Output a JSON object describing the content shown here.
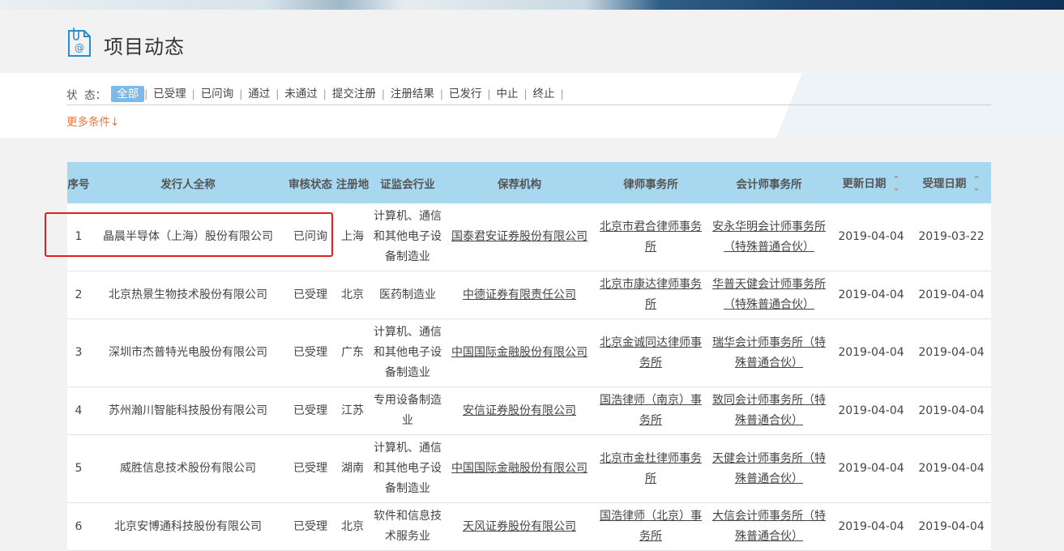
{
  "page": {
    "title": "项目动态"
  },
  "filter": {
    "label": "状  态：",
    "options": [
      "全部",
      "已受理",
      "已问询",
      "通过",
      "未通过",
      "提交注册",
      "注册结果",
      "已发行",
      "中止",
      "终止"
    ],
    "more": "更多条件↓"
  },
  "table": {
    "headers": [
      "序号",
      "发行人全称",
      "审核状态",
      "注册地",
      "证监会行业",
      "保荐机构",
      "律师事务所",
      "会计师事务所",
      "更新日期",
      "受理日期"
    ],
    "rows": [
      {
        "no": "1",
        "name": "晶晨半导体（上海）股份有限公司",
        "status": "已问询",
        "region": "上海",
        "industry": "计算机、通信和其他电子设备制造业",
        "sponsor": "国泰君安证券股份有限公司",
        "law": "北京市君合律师事务所",
        "account": "安永华明会计师事务所（特殊普通合伙）",
        "updated": "2019-04-04",
        "accepted": "2019-03-22"
      },
      {
        "no": "2",
        "name": "北京热景生物技术股份有限公司",
        "status": "已受理",
        "region": "北京",
        "industry": "医药制造业",
        "sponsor": "中德证券有限责任公司",
        "law": "北京市康达律师事务所",
        "account": "华普天健会计师事务所（特殊普通合伙）",
        "updated": "2019-04-04",
        "accepted": "2019-04-04"
      },
      {
        "no": "3",
        "name": "深圳市杰普特光电股份有限公司",
        "status": "已受理",
        "region": "广东",
        "industry": "计算机、通信和其他电子设备制造业",
        "sponsor": "中国国际金融股份有限公司",
        "law": "北京金诚同达律师事务所",
        "account": "瑞华会计师事务所（特殊普通合伙）",
        "updated": "2019-04-04",
        "accepted": "2019-04-04"
      },
      {
        "no": "4",
        "name": "苏州瀚川智能科技股份有限公司",
        "status": "已受理",
        "region": "江苏",
        "industry": "专用设备制造业",
        "sponsor": "安信证券股份有限公司",
        "law": "国浩律师（南京）事务所",
        "account": "致同会计师事务所（特殊普通合伙）",
        "updated": "2019-04-04",
        "accepted": "2019-04-04"
      },
      {
        "no": "5",
        "name": "威胜信息技术股份有限公司",
        "status": "已受理",
        "region": "湖南",
        "industry": "计算机、通信和其他电子设备制造业",
        "sponsor": "中国国际金融股份有限公司",
        "law": "北京市金杜律师事务所",
        "account": "天健会计师事务所（特殊普通合伙）",
        "updated": "2019-04-04",
        "accepted": "2019-04-04"
      },
      {
        "no": "6",
        "name": "北京安博通科技股份有限公司",
        "status": "已受理",
        "region": "北京",
        "industry": "软件和信息技术服务业",
        "sponsor": "天风证券股份有限公司",
        "law": "国浩律师（北京）事务所",
        "account": "大信会计师事务所（特殊普通合伙）",
        "updated": "2019-04-04",
        "accepted": "2019-04-04"
      }
    ]
  },
  "colors": {
    "header_bg": "#a7d8f0",
    "active_filter": "#7cb9e8",
    "more_link": "#e9763b",
    "highlight": "#e02020"
  }
}
